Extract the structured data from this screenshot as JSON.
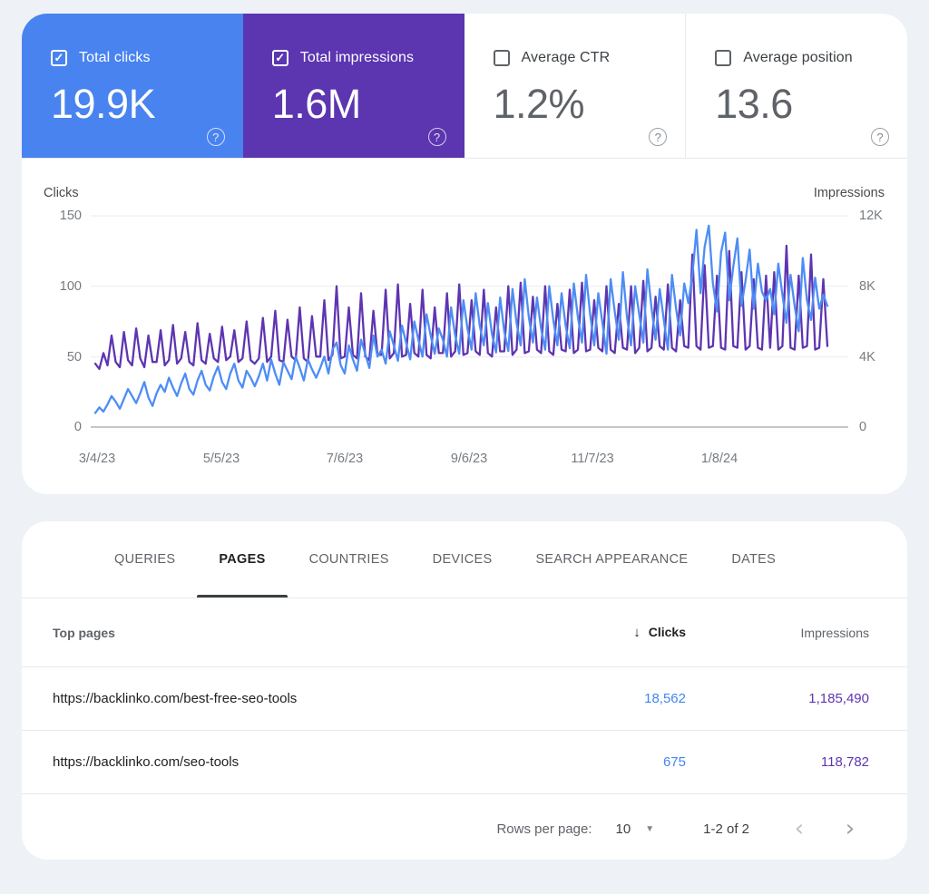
{
  "icons": {
    "check": "✓",
    "help": "?",
    "sort_desc": "↓",
    "dropdown_caret": "▼",
    "chevron_left": "‹",
    "chevron_right": "›"
  },
  "colors": {
    "clicks_blue": "#4d8df5",
    "impressions_purple": "#5e35b1",
    "card_blue_bg": "#4883f0",
    "card_purple_bg": "#5c35b0",
    "clicks_value_text": "#4285f4",
    "impressions_value_text": "#5e35b1"
  },
  "metrics": {
    "cards": [
      {
        "label": "Total clicks",
        "value": "19.9K",
        "checked": true
      },
      {
        "label": "Total impressions",
        "value": "1.6M",
        "checked": true
      },
      {
        "label": "Average CTR",
        "value": "1.2%",
        "checked": false
      },
      {
        "label": "Average position",
        "value": "13.6",
        "checked": false
      }
    ]
  },
  "chart_data": {
    "type": "line",
    "title": "",
    "grid": true,
    "legend_position": "none",
    "left_axis": {
      "label": "Clicks",
      "ticks": [
        "150",
        "100",
        "50",
        "0"
      ],
      "range": [
        0,
        150
      ]
    },
    "right_axis": {
      "label": "Impressions",
      "ticks": [
        "12K",
        "8K",
        "4K",
        "0"
      ],
      "range": [
        0,
        12000
      ]
    },
    "x_ticks": [
      "3/4/23",
      "5/5/23",
      "7/6/23",
      "9/6/23",
      "11/7/23",
      "1/8/24"
    ],
    "series": [
      {
        "name": "Impressions",
        "axis": "right",
        "color": "#5e35b1",
        "values": [
          3600,
          3300,
          4200,
          3500,
          5200,
          3700,
          3400,
          5400,
          3800,
          3500,
          5600,
          3900,
          3400,
          5200,
          3700,
          3700,
          5500,
          3500,
          3800,
          5800,
          3600,
          3900,
          5400,
          3700,
          3500,
          5900,
          3800,
          3600,
          5300,
          3900,
          3700,
          5700,
          3800,
          4000,
          5500,
          3700,
          3900,
          6000,
          3800,
          3600,
          3900,
          6200,
          3700,
          4000,
          6600,
          3800,
          3700,
          6100,
          4000,
          3800,
          6800,
          3900,
          3700,
          6300,
          4000,
          4000,
          7200,
          3800,
          4100,
          8000,
          3900,
          4000,
          6800,
          4100,
          3900,
          7600,
          4000,
          3800,
          6600,
          4100,
          4100,
          7800,
          3900,
          4200,
          8100,
          4000,
          4100,
          7000,
          4200,
          4000,
          7800,
          4100,
          3900,
          6800,
          4200,
          4200,
          7600,
          4000,
          4300,
          8100,
          4100,
          4200,
          7200,
          4300,
          4100,
          7800,
          4200,
          4000,
          6800,
          4300,
          4300,
          8000,
          4100,
          4400,
          8200,
          4200,
          4300,
          7400,
          4400,
          4200,
          8000,
          4300,
          4100,
          7000,
          4400,
          4300,
          7800,
          4200,
          4400,
          8200,
          4300,
          4400,
          7200,
          4500,
          4300,
          8000,
          4400,
          4200,
          7000,
          4500,
          4400,
          8000,
          4200,
          4500,
          8300,
          4300,
          4500,
          7400,
          4600,
          4400,
          8100,
          4500,
          4300,
          7200,
          4600,
          4500,
          9800,
          4600,
          4400,
          9200,
          4500,
          4600,
          8600,
          4500,
          4400,
          10000,
          4600,
          4500,
          8800,
          4400,
          4600,
          8400,
          4500,
          4400,
          8600,
          4500,
          8800,
          4400,
          4600,
          10300,
          4500,
          4400,
          8600,
          4500,
          4600,
          9800,
          4400,
          4500,
          8400,
          4600
        ]
      },
      {
        "name": "Clicks",
        "axis": "left",
        "color": "#4d8df5",
        "values": [
          10,
          14,
          11,
          16,
          22,
          18,
          13,
          20,
          27,
          22,
          17,
          24,
          32,
          21,
          15,
          24,
          30,
          25,
          35,
          28,
          22,
          31,
          38,
          27,
          23,
          33,
          40,
          30,
          26,
          36,
          43,
          32,
          27,
          38,
          45,
          33,
          28,
          40,
          35,
          29,
          36,
          45,
          33,
          48,
          38,
          30,
          46,
          40,
          34,
          50,
          42,
          33,
          48,
          41,
          35,
          42,
          50,
          38,
          55,
          60,
          44,
          38,
          58,
          48,
          40,
          62,
          52,
          42,
          65,
          50,
          55,
          45,
          68,
          58,
          47,
          72,
          60,
          48,
          75,
          62,
          50,
          80,
          65,
          52,
          70,
          62,
          50,
          85,
          65,
          52,
          90,
          70,
          55,
          95,
          72,
          58,
          88,
          66,
          53,
          92,
          68,
          54,
          98,
          74,
          58,
          105,
          78,
          60,
          92,
          70,
          55,
          100,
          76,
          58,
          95,
          72,
          56,
          102,
          78,
          60,
          108,
          80,
          58,
          95,
          74,
          52,
          105,
          82,
          62,
          110,
          78,
          58,
          100,
          80,
          60,
          112,
          85,
          62,
          98,
          76,
          55,
          108,
          84,
          65,
          102,
          88,
          108,
          140,
          95,
          128,
          143,
          102,
          82,
          124,
          138,
          90,
          114,
          134,
          86,
          104,
          126,
          84,
          116,
          96,
          90,
          98,
          80,
          116,
          94,
          74,
          108,
          86,
          68,
          120,
          90,
          76,
          106,
          84,
          94,
          86
        ]
      }
    ]
  },
  "tabs": [
    {
      "label": "QUERIES",
      "active": false
    },
    {
      "label": "PAGES",
      "active": true
    },
    {
      "label": "COUNTRIES",
      "active": false
    },
    {
      "label": "DEVICES",
      "active": false
    },
    {
      "label": "SEARCH APPEARANCE",
      "active": false
    },
    {
      "label": "DATES",
      "active": false
    }
  ],
  "table": {
    "columns": {
      "pages": "Top pages",
      "clicks": "Clicks",
      "impressions": "Impressions"
    },
    "rows": [
      {
        "url": "https://backlinko.com/best-free-seo-tools",
        "clicks": "18,562",
        "impressions": "1,185,490"
      },
      {
        "url": "https://backlinko.com/seo-tools",
        "clicks": "675",
        "impressions": "118,782"
      }
    ],
    "footer": {
      "rows_per_page_label": "Rows per page:",
      "rows_per_page_value": "10",
      "range": "1-2 of 2"
    }
  }
}
